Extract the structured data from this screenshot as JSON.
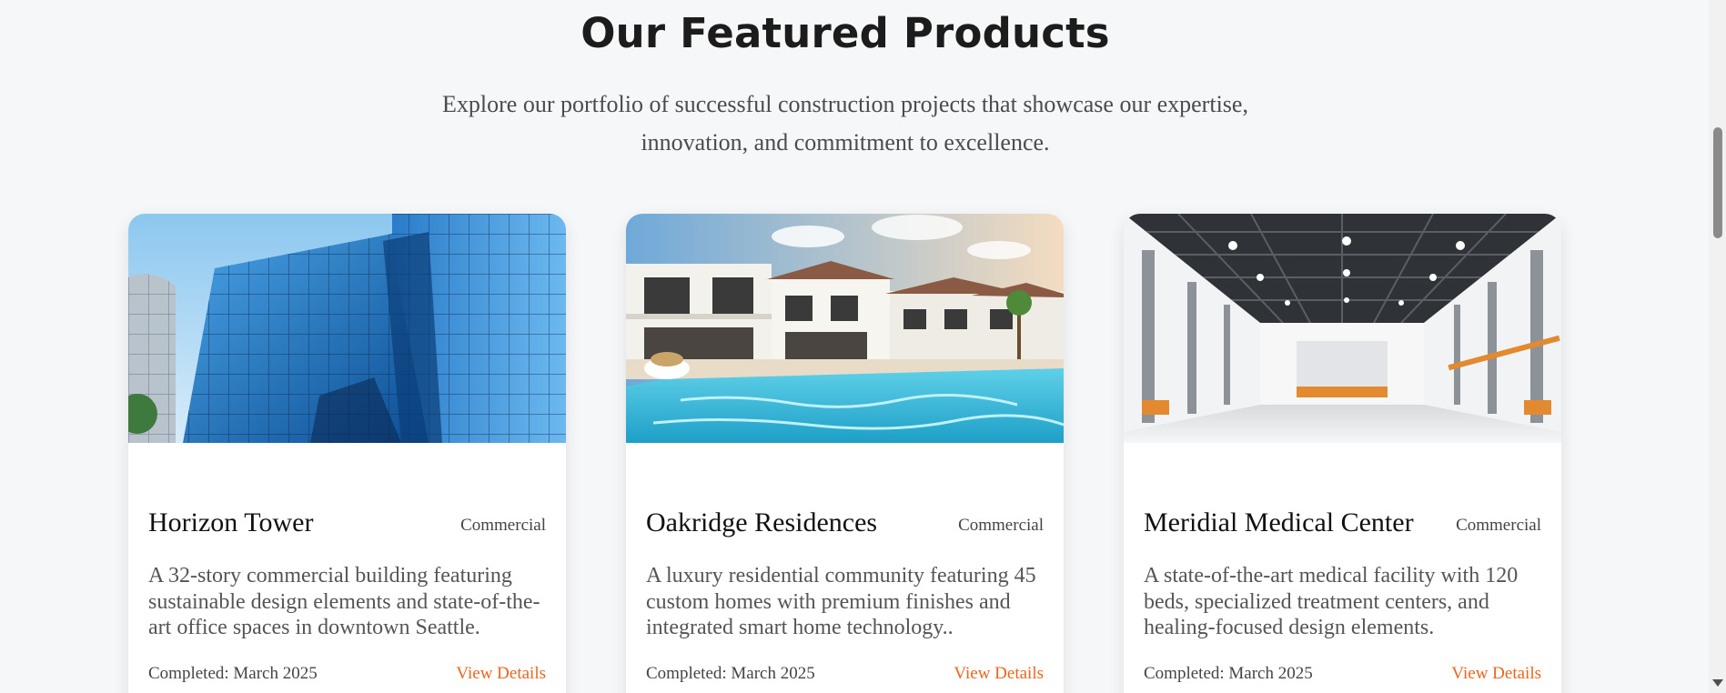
{
  "section": {
    "title": "Our Featured Products",
    "subtitle_line1": "Explore our portfolio of successful construction projects that showcase our expertise,",
    "subtitle_line2": "innovation, and commitment to excellence."
  },
  "products": [
    {
      "title": "Horizon Tower",
      "category": "Commercial",
      "description": "A 32-story commercial building featuring sustainable design elements and state-of-the-art office spaces in downtown Seattle.",
      "completed": "Completed: March 2025",
      "link_label": "View Details",
      "image_subject": "glass-skyscraper"
    },
    {
      "title": "Oakridge Residences",
      "category": "Commercial",
      "description": "A luxury residential community featuring 45 custom homes with premium finishes and integrated smart home technology..",
      "completed": "Completed: March 2025",
      "link_label": "View Details",
      "image_subject": "villas-with-pool"
    },
    {
      "title": "Meridial Medical Center",
      "category": "Commercial",
      "description": "A state-of-the-art medical facility with 120 beds, specialized treatment centers, and healing-focused design elements.",
      "completed": "Completed: March 2025",
      "link_label": "View Details",
      "image_subject": "warehouse-interior"
    }
  ],
  "colors": {
    "accent": "#f0641e",
    "background": "#f6f7f9",
    "card": "#ffffff"
  }
}
